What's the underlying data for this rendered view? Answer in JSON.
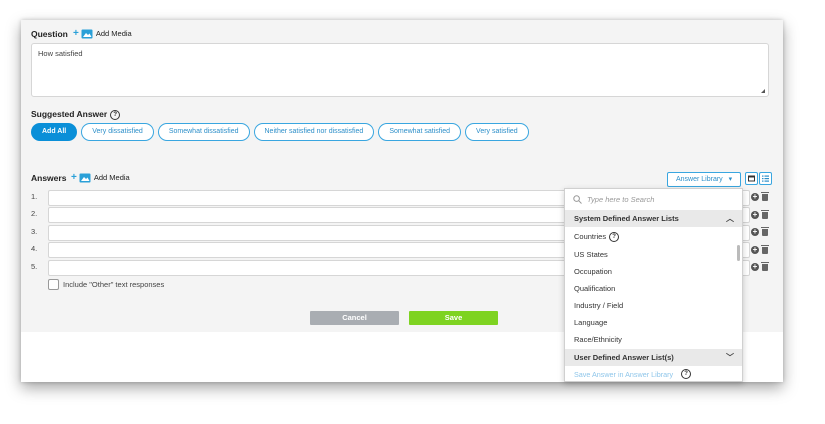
{
  "question": {
    "label": "Question",
    "add_media": "Add Media",
    "text": "How satisfied"
  },
  "suggested": {
    "label": "Suggested Answer",
    "add_all": "Add All",
    "chips": [
      "Very dissatisfied",
      "Somewhat dissatisfied",
      "Neither satisfied nor dissatisfied",
      "Somewhat satisfied",
      "Very satisfied"
    ]
  },
  "answers": {
    "label": "Answers",
    "add_media": "Add Media",
    "rows": [
      "1.",
      "2.",
      "3.",
      "4.",
      "5."
    ],
    "other_checkbox_label": "Include \"Other\" text responses"
  },
  "library": {
    "button_label": "Answer Library",
    "search_placeholder": "Type here to Search",
    "system_header": "System Defined Answer Lists",
    "system_items": [
      "Countries",
      "US States",
      "Occupation",
      "Qualification",
      "Industry / Field",
      "Language",
      "Race/Ethnicity"
    ],
    "user_header": "User Defined Answer List(s)",
    "save_link": "Save Answer in Answer Library"
  },
  "actions": {
    "cancel": "Cancel",
    "save": "Save"
  },
  "colors": {
    "accent": "#0a8fd8",
    "save_green": "#7ed321",
    "cancel_gray": "#a9adb2"
  }
}
